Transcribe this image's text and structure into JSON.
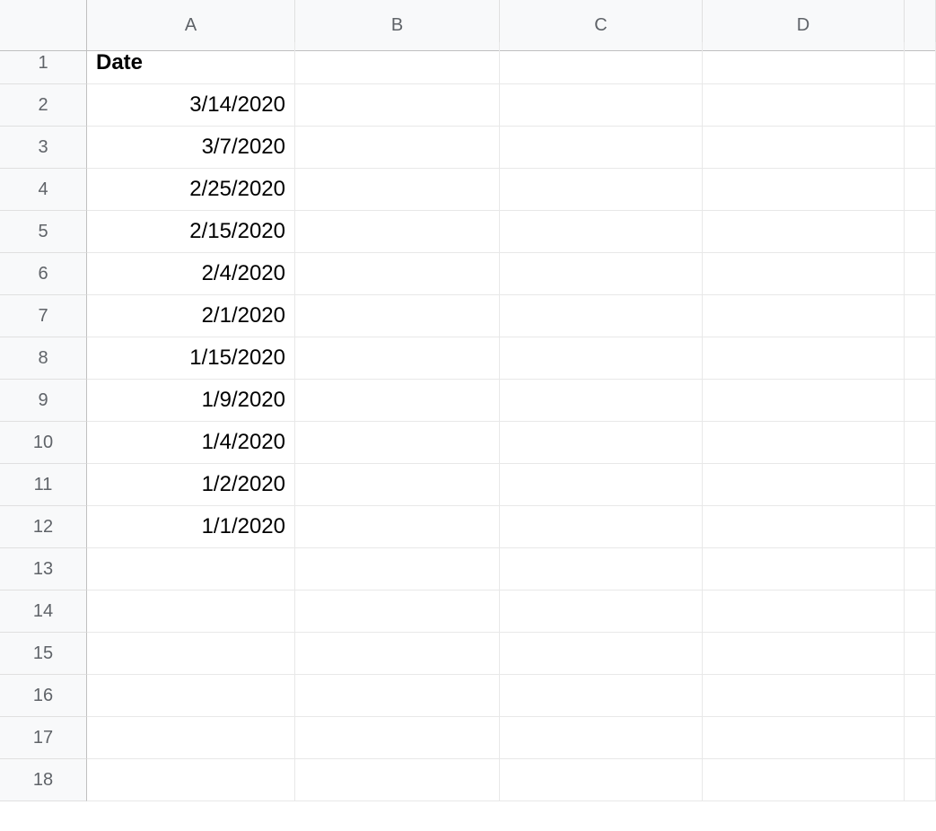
{
  "columns": [
    "A",
    "B",
    "C",
    "D",
    ""
  ],
  "rowCount": 18,
  "cells": {
    "A1": {
      "value": "Date",
      "bold": true,
      "align": "left"
    },
    "A2": {
      "value": "3/14/2020",
      "align": "right"
    },
    "A3": {
      "value": "3/7/2020",
      "align": "right"
    },
    "A4": {
      "value": "2/25/2020",
      "align": "right"
    },
    "A5": {
      "value": "2/15/2020",
      "align": "right"
    },
    "A6": {
      "value": "2/4/2020",
      "align": "right"
    },
    "A7": {
      "value": "2/1/2020",
      "align": "right"
    },
    "A8": {
      "value": "1/15/2020",
      "align": "right"
    },
    "A9": {
      "value": "1/9/2020",
      "align": "right"
    },
    "A10": {
      "value": "1/4/2020",
      "align": "right"
    },
    "A11": {
      "value": "1/2/2020",
      "align": "right"
    },
    "A12": {
      "value": "1/1/2020",
      "align": "right"
    }
  }
}
